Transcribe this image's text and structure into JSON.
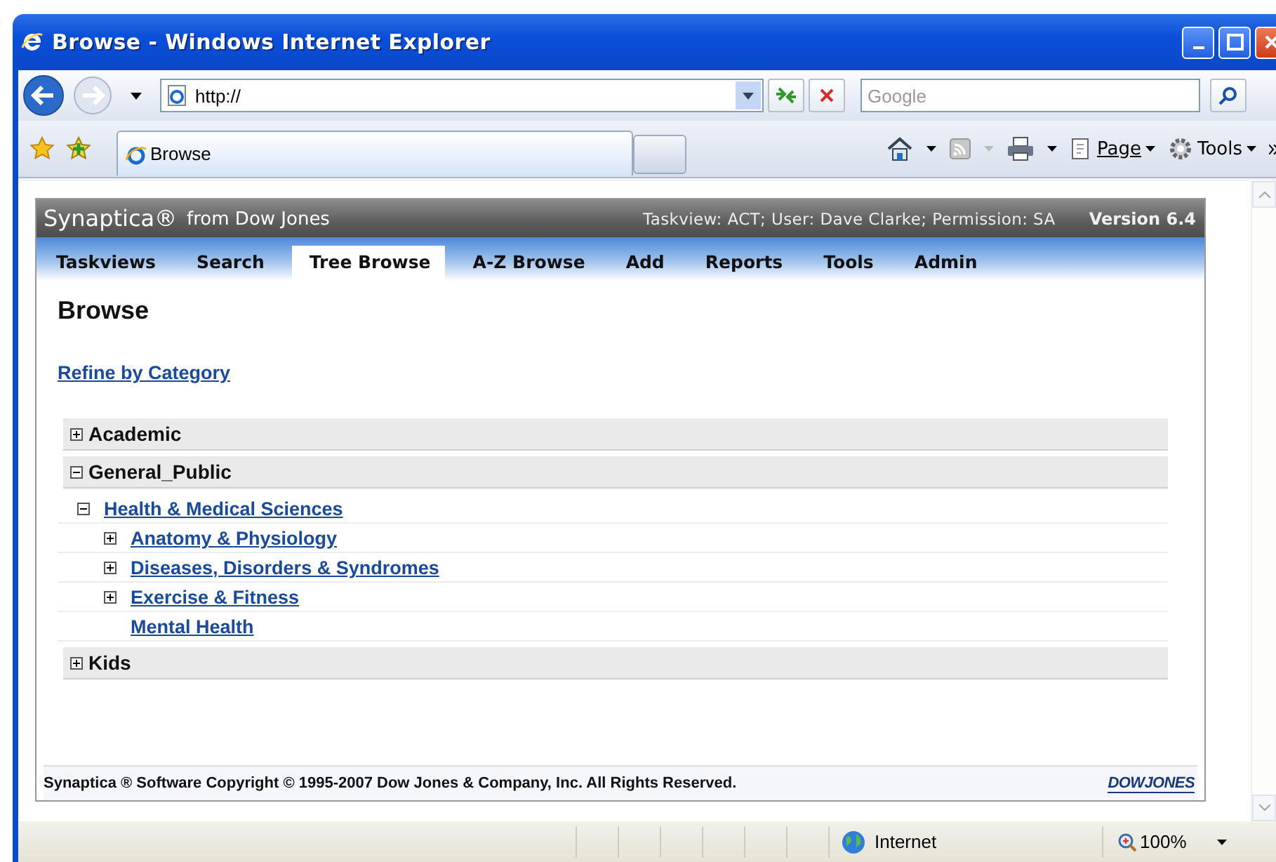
{
  "window": {
    "title": "Browse - Windows Internet Explorer"
  },
  "address_bar": {
    "value": "http://"
  },
  "search_box": {
    "placeholder": "Google"
  },
  "browser_tab": {
    "label": "Browse"
  },
  "command_bar": {
    "page": "Page",
    "tools": "Tools"
  },
  "app": {
    "brand": "Synaptica®",
    "brand_suffix": "from Dow Jones",
    "session": "Taskview: ACT; User: Dave Clarke; Permission: SA",
    "version": "Version 6.4"
  },
  "nav_tabs": [
    {
      "label": "Taskviews",
      "selected": false
    },
    {
      "label": "Search",
      "selected": false
    },
    {
      "label": "Tree Browse",
      "selected": true
    },
    {
      "label": "A-Z Browse",
      "selected": false
    },
    {
      "label": "Add",
      "selected": false
    },
    {
      "label": "Reports",
      "selected": false
    },
    {
      "label": "Tools",
      "selected": false
    },
    {
      "label": "Admin",
      "selected": false
    }
  ],
  "heading": "Browse",
  "refine_link": "Refine by Category",
  "tree": [
    {
      "label": "Academic",
      "expanded": false
    },
    {
      "label": "General_Public",
      "expanded": true,
      "children": [
        {
          "label": "Health & Medical Sciences",
          "expanded": true,
          "children": [
            {
              "label": "Anatomy & Physiology",
              "expanded": false
            },
            {
              "label": "Diseases, Disorders & Syndromes",
              "expanded": false
            },
            {
              "label": "Exercise & Fitness",
              "expanded": false
            },
            {
              "label": "Mental Health"
            }
          ]
        }
      ]
    },
    {
      "label": "Kids",
      "expanded": false
    }
  ],
  "footer": {
    "copyright": "Synaptica ® Software Copyright © 1995-2007 Dow Jones & Company, Inc. All Rights Reserved.",
    "logo": "DOWJONES"
  },
  "status_bar": {
    "zone": "Internet",
    "zoom": "100%"
  }
}
